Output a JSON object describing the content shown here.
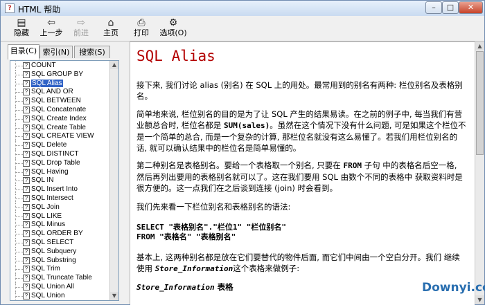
{
  "window": {
    "title": "HTML 帮助"
  },
  "toolbar": {
    "buttons": [
      {
        "label": "隐藏",
        "icon": "hide-icon"
      },
      {
        "label": "上一步",
        "icon": "back-arrow-icon"
      },
      {
        "label": "前进",
        "icon": "forward-arrow-icon"
      },
      {
        "label": "主页",
        "icon": "home-icon"
      },
      {
        "label": "打印",
        "icon": "print-icon"
      },
      {
        "label": "选项(O)",
        "icon": "options-icon"
      }
    ]
  },
  "tabs": [
    {
      "label": "目录(C)"
    },
    {
      "label": "索引(N)"
    },
    {
      "label": "搜索(S)"
    }
  ],
  "tree": {
    "items": [
      "COUNT",
      "SQL GROUP BY",
      "SQL Alias",
      "SQL AND OR",
      "SQL BETWEEN",
      "SQL Concatenate",
      "SQL Create Index",
      "SQL Create Table",
      "SQL CREATE VIEW",
      "SQL Delete",
      "SQL DISTINCT",
      "SQL Drop Table",
      "SQL Having",
      "SQL IN",
      "SQL Insert Into",
      "SQL Intersect",
      "SQL Join",
      "SQL LIKE",
      "SQL Minus",
      "SQL ORDER BY",
      "SQL SELECT",
      "SQL Subquery",
      "SQL Substring",
      "SQL Trim",
      "SQL Truncate Table",
      "SQL Union All",
      "SQL Union"
    ],
    "selected": "SQL Alias"
  },
  "content": {
    "title": "SQL Alias",
    "p1": "接下来, 我们讨论 alias (别名) 在 SQL 上的用处。最常用到的别名有两种: 栏位别名及表格别名。",
    "p2a": "简单地来说, 栏位别名的目的是为了让 SQL 产生的结果易读。在之前的例子中, 每当我们有营业额总合时, 栏位名都是 ",
    "p2code": "SUM(sales)",
    "p2b": "。虽然在这个情况下没有什么问题, 可是如果这个栏位不是一个简单的总合, 而是一个复杂的计算, 那栏位名就没有这么易懂了。若我们用栏位别名的话, 就可以确认结果中的栏位名是简单易懂的。",
    "p3a": "第二种别名是表格别名。要给一个表格取一个别名, 只要在 ",
    "p3code": "FROM",
    "p3b": " 子句 中的表格名后空一格, 然后再列出要用的表格别名就可以了。这在我们要用 SQL 由数个不同的表格中 获取资料时是很方便的。这一点我们在之后谈到连接 (join) 时会看到。",
    "p4": "我们先来看一下栏位别名和表格别名的语法:",
    "code1": "SELECT \"表格别名\".\"栏位1\" \"栏位别名\"",
    "code2": "FROM \"表格名\" \"表格别名\"",
    "p5a": "基本上, 这两种别名都是放在它们要替代的物件后面, 而它们中间由一个空白分开。我们 继续使用 ",
    "p5code": "Store_Information",
    "p5b": "这个表格来做例子:",
    "p6code": "Store_Information",
    "p6b": " 表格"
  },
  "watermark": "Downyi.com"
}
